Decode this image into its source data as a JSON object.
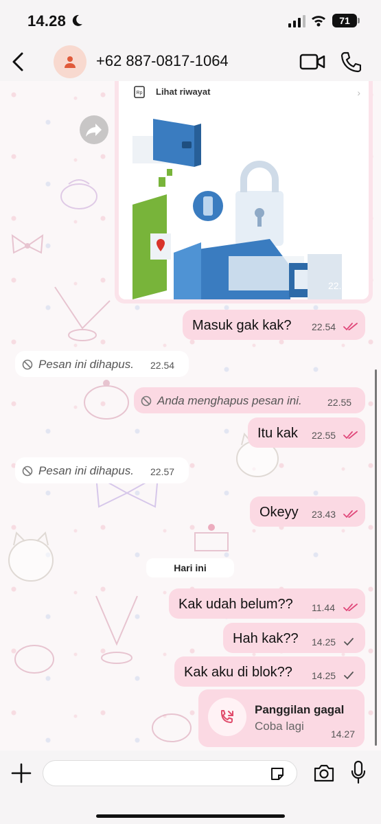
{
  "status_bar": {
    "time": "14.28",
    "battery": "71"
  },
  "header": {
    "contact": "+62 887-0817-1064"
  },
  "image_message": {
    "history_label": "Lihat riwayat",
    "time": "22.53"
  },
  "messages": [
    {
      "text": "Masuk gak kak?",
      "time": "22.54",
      "direction": "out",
      "status": "read"
    },
    {
      "text": "Pesan ini dihapus.",
      "time": "22.54",
      "direction": "in",
      "deleted": true
    },
    {
      "text": "Anda menghapus pesan ini.",
      "time": "22.55",
      "direction": "out",
      "deleted": true
    },
    {
      "text": "Itu kak",
      "time": "22.55",
      "direction": "out",
      "status": "read"
    },
    {
      "text": "Pesan ini dihapus.",
      "time": "22.57",
      "direction": "in",
      "deleted": true
    },
    {
      "text": "Okeyy",
      "time": "23.43",
      "direction": "out",
      "status": "read"
    },
    {
      "text": "Kak udah belum??",
      "time": "11.44",
      "direction": "out",
      "status": "read"
    },
    {
      "text": "Hah kak??",
      "time": "14.25",
      "direction": "out",
      "status": "sent"
    },
    {
      "text": "Kak aku di blok??",
      "time": "14.25",
      "direction": "out",
      "status": "sent"
    }
  ],
  "day_divider": "Hari ini",
  "missed_call": {
    "title": "Panggilan gagal",
    "subtitle": "Coba lagi",
    "time": "14.27"
  },
  "colors": {
    "bubble_out": "#fbd9e3",
    "bubble_in": "#ffffff",
    "read_tick": "#e0487a",
    "sent_tick": "#555555",
    "call_accent": "#e04a6a"
  },
  "input": {
    "placeholder": ""
  }
}
